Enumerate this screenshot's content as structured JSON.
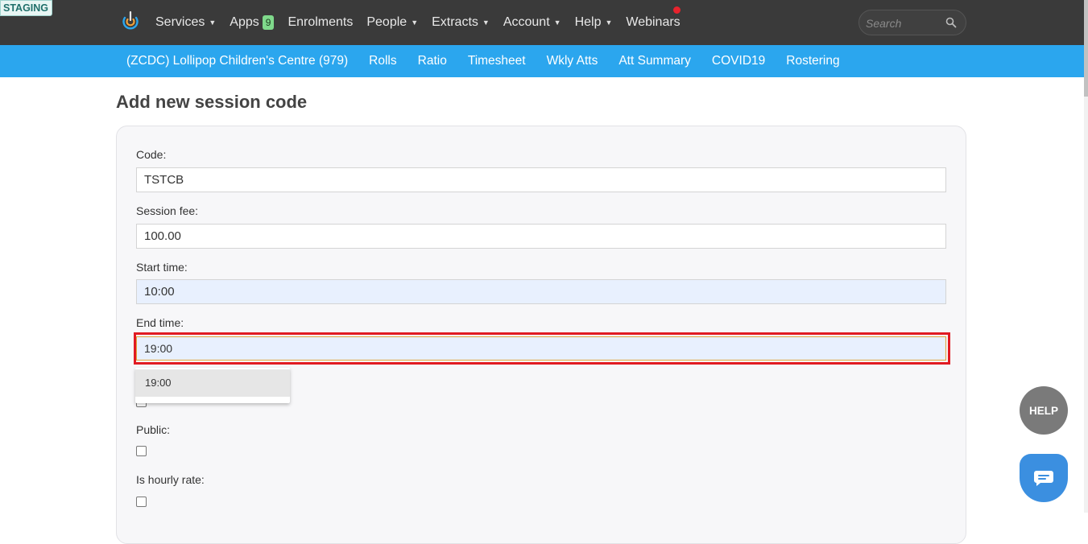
{
  "env_badge": "STAGING",
  "topnav": {
    "items": [
      {
        "label": "Services",
        "has_caret": true
      },
      {
        "label": "Apps",
        "badge": "9"
      },
      {
        "label": "Enrolments"
      },
      {
        "label": "People",
        "has_caret": true
      },
      {
        "label": "Extracts",
        "has_caret": true
      },
      {
        "label": "Account",
        "has_caret": true
      },
      {
        "label": "Help",
        "has_caret": true
      },
      {
        "label": "Webinars",
        "notification_dot": true
      }
    ],
    "search_placeholder": "Search"
  },
  "subnav": {
    "items": [
      "(ZCDC) Lollipop Children's Centre (979)",
      "Rolls",
      "Ratio",
      "Timesheet",
      "Wkly Atts",
      "Att Summary",
      "COVID19",
      "Rostering"
    ]
  },
  "form": {
    "title": "Add new session code",
    "code_label": "Code:",
    "code_value": "TSTCB",
    "fee_label": "Session fee:",
    "fee_value": "100.00",
    "start_label": "Start time:",
    "start_value": "10:00",
    "end_label": "End time:",
    "end_value": "19:00",
    "end_suggestion": "19:00",
    "public_label": "Public:",
    "hourly_label": "Is hourly rate:"
  },
  "floating": {
    "help_label": "HELP"
  },
  "colors": {
    "topnav_bg": "#3a3a3a",
    "subnav_bg": "#2ba6ee",
    "highlight_border": "#e11b22",
    "apps_badge": "#7fd98b"
  }
}
